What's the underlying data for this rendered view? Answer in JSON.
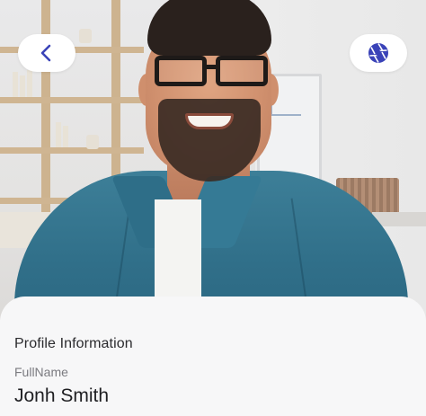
{
  "header": {
    "back_icon": "chevron-left-icon",
    "camera_icon": "camera-aperture-icon",
    "accent_color": "#3a43b8"
  },
  "profile": {
    "photo_description": "man-with-glasses-smiling",
    "section_title": "Profile Information",
    "fields": [
      {
        "label": "FullName",
        "value": "Jonh Smith"
      }
    ]
  }
}
